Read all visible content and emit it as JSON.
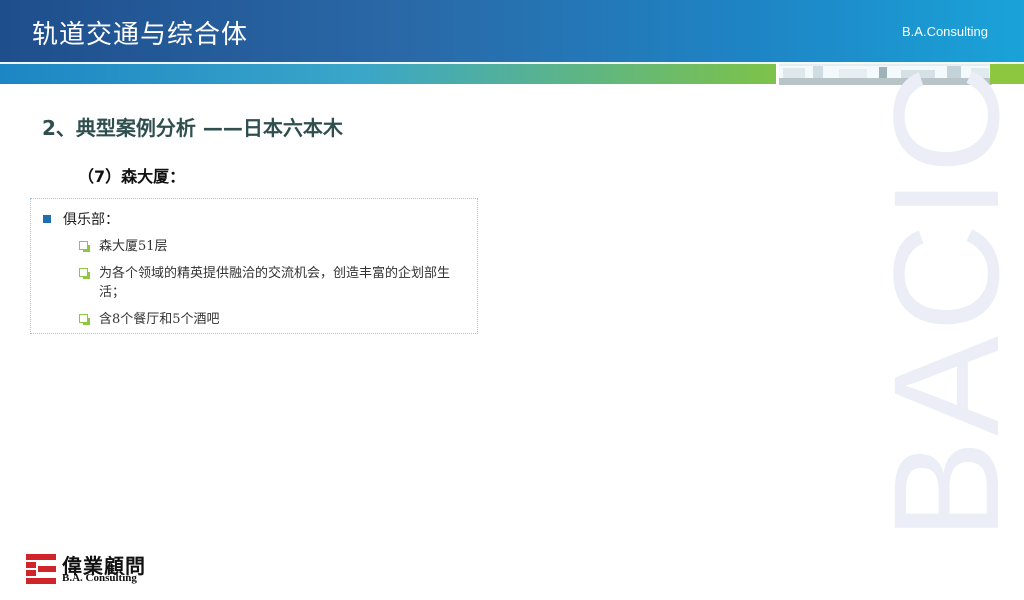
{
  "header": {
    "title": "轨道交通与综合体",
    "brand": "B.A.Consulting"
  },
  "section": {
    "title": "2、典型案例分析 ——日本六本木",
    "subtitle": "（7）森大厦："
  },
  "content": {
    "main_bullet": "俱乐部：",
    "items": [
      "森大厦51层",
      "为各个领域的精英提供融洽的交流机会，创造丰富的企划部生活；",
      "含8个餐厅和5个酒吧"
    ]
  },
  "watermark": "BACIC",
  "logo": {
    "cn": "偉業顧問",
    "en": "B.A. Consulting",
    "accent_color": "#d1232a"
  },
  "colors": {
    "header_start": "#1f4e8c",
    "header_end": "#1aa3d8",
    "stripe_green": "#8dc63f",
    "bullet_blue": "#1e6fb0"
  }
}
